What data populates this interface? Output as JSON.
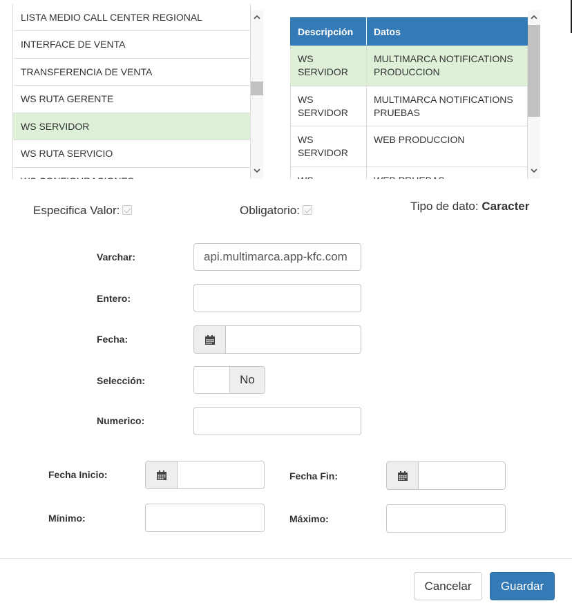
{
  "left_list": {
    "items": [
      {
        "label": "LISTA MEDIO CALL CENTER REGIONAL",
        "selected": false
      },
      {
        "label": "INTERFACE DE VENTA",
        "selected": false
      },
      {
        "label": "TRANSFERENCIA DE VENTA",
        "selected": false
      },
      {
        "label": "WS RUTA GERENTE",
        "selected": false
      },
      {
        "label": "WS SERVIDOR",
        "selected": true
      },
      {
        "label": "WS RUTA SERVICIO",
        "selected": false
      },
      {
        "label": "WS CONFIGURACIONES",
        "selected": false
      }
    ]
  },
  "right_table": {
    "headers": {
      "descripcion": "Descripción",
      "datos": "Datos"
    },
    "rows": [
      {
        "descripcion": "WS SERVIDOR",
        "datos": "MULTIMARCA NOTIFICATIONS PRODUCCION",
        "selected": true
      },
      {
        "descripcion": "WS SERVIDOR",
        "datos": "MULTIMARCA NOTIFICATIONS PRUEBAS",
        "selected": false
      },
      {
        "descripcion": "WS SERVIDOR",
        "datos": "WEB PRODUCCION",
        "selected": false
      },
      {
        "descripcion": "WS SERVIDOR",
        "datos": "WEB PRUEBAS",
        "selected": false
      }
    ]
  },
  "flags": {
    "especifica_valor_label": "Especifica Valor:",
    "obligatorio_label": "Obligatorio:",
    "tipo_dato_label": "Tipo de dato:",
    "tipo_dato_value": "Caracter"
  },
  "form": {
    "varchar_label": "Varchar:",
    "varchar_value": "api.multimarca.app-kfc.com",
    "entero_label": "Entero:",
    "fecha_label": "Fecha:",
    "seleccion_label": "Selección:",
    "seleccion_value": "No",
    "numerico_label": "Numerico:",
    "fecha_inicio_label": "Fecha Inicio:",
    "fecha_fin_label": "Fecha Fin:",
    "minimo_label": "Mínimo:",
    "maximo_label": "Máximo:"
  },
  "footer": {
    "cancel_label": "Cancelar",
    "save_label": "Guardar"
  },
  "icons": {
    "calendar": "calendar-icon",
    "scroll_up": "chevron-up-icon",
    "scroll_down": "chevron-down-icon"
  },
  "colors": {
    "primary": "#337ab7",
    "selected_row": "#dff0d8"
  }
}
